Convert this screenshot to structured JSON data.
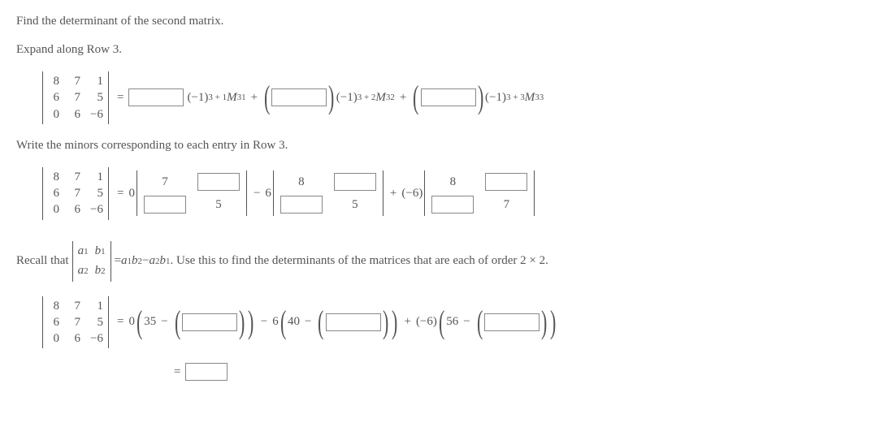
{
  "title": "Find the determinant of the second matrix.",
  "step1": "Expand along Row 3.",
  "matrix3": {
    "r1": [
      "8",
      "7",
      " 1"
    ],
    "r2": [
      "6",
      "7",
      " 5"
    ],
    "r3": [
      "0",
      "6",
      "−6"
    ]
  },
  "expansion": {
    "t1a": "(−1)",
    "t1exp": "3 + 1",
    "t1M": "M",
    "t1sub": "31",
    "t2a": "(−1)",
    "t2exp": "3 + 2",
    "t2M": "M",
    "t2sub": "32",
    "t3a": "(−1)",
    "t3exp": "3 + 3",
    "t3M": "M",
    "t3sub": "33",
    "plus": "+"
  },
  "step2": "Write the minors corresponding to each entry in Row 3.",
  "minors": {
    "c1": "0",
    "c2": "6",
    "c3": "(−6)",
    "m1": {
      "tl": "7",
      "bl_fixed": "",
      "tr_fixed": "",
      "br": "5"
    },
    "m2": {
      "tl": "8",
      "bl_fixed": "",
      "tr_fixed": "",
      "br": "5"
    },
    "m3": {
      "tl": "8",
      "bl_fixed": "",
      "tr_fixed": "",
      "br": "7"
    },
    "minus": "−",
    "plus": "+"
  },
  "recall": {
    "pre": "Recall that ",
    "a1": "a",
    "b1": "b",
    "s1": "1",
    "s2": "2",
    "rhs": " = ",
    "expr1": "a",
    "expr2": "b",
    "expr3": " − ",
    "expr4": "a",
    "expr5": "b",
    "post": ". Use this to find the determinants of the matrices that are each of order 2 × 2."
  },
  "calc": {
    "c0": "0",
    "v0": "35",
    "minus": "−",
    "c1": "6",
    "v1": "40",
    "c2": "(−6)",
    "v2": "56",
    "plus": "+"
  },
  "final_eq": "="
}
